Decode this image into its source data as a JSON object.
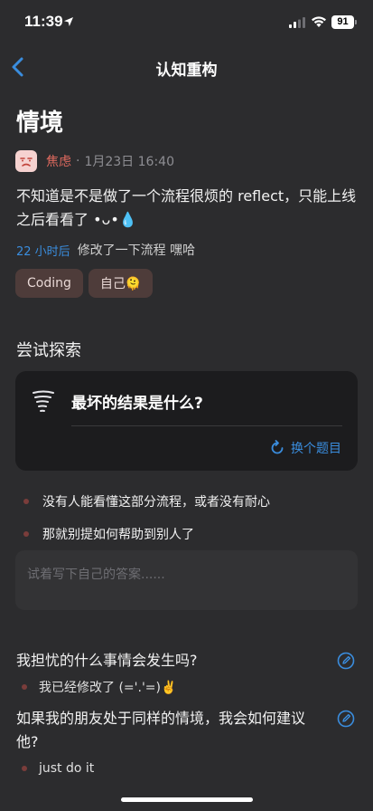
{
  "status_bar": {
    "time": "11:39",
    "battery": "91"
  },
  "nav": {
    "title": "认知重构"
  },
  "page": {
    "title": "情境"
  },
  "mood": {
    "label": "焦虑",
    "separator": "·",
    "date": "1月23日 16:40"
  },
  "entry": {
    "text": "不知道是不是做了一个流程很烦的 reflect，只能上线之后看看了 •ᴗ•💧",
    "ago": "22 小时后",
    "note": "修改了一下流程 嘿哈"
  },
  "tags": [
    {
      "label": "Coding"
    },
    {
      "label": "自己🫠"
    }
  ],
  "explore": {
    "section_title": "尝试探索",
    "question": "最坏的结果是什么?",
    "change_label": "换个题目",
    "answers": [
      "没有人能看懂这部分流程，或者没有耐心",
      "那就别提如何帮助到别人了"
    ],
    "input_placeholder": "试着写下自己的答案......"
  },
  "questions": [
    {
      "title": "我担忧的什么事情会发生吗?",
      "answer": "我已经修改了 (='.'=)✌️"
    },
    {
      "title": "如果我的朋友处于同样的情境，我会如何建议他?",
      "answer": "just do it"
    }
  ],
  "colors": {
    "accent": "#3a8dde",
    "mood": "#e06a5f",
    "background": "#2c2c2e",
    "card": "#1c1c1e",
    "tag": "#4e3c3a"
  }
}
